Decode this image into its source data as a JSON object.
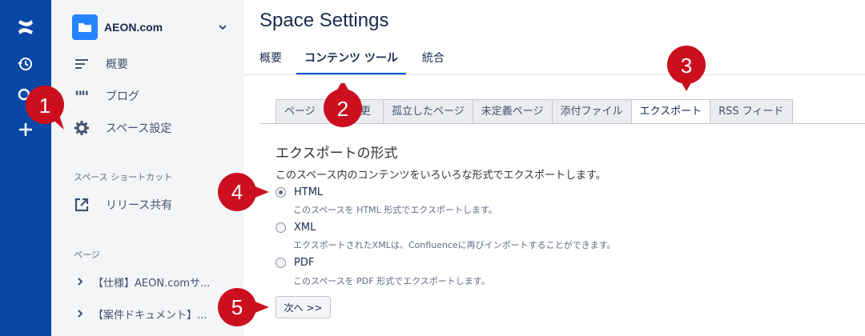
{
  "rail": {
    "icons": [
      "confluence-logo-icon",
      "recent-history-icon",
      "search-icon",
      "create-plus-icon"
    ]
  },
  "sidebar": {
    "space_name": "AEON.com",
    "nav": [
      {
        "label": "概要",
        "icon": "overview-icon"
      },
      {
        "label": "ブログ",
        "icon": "blog-quote-icon"
      },
      {
        "label": "スペース設定",
        "icon": "gear-icon"
      }
    ],
    "shortcuts_title": "スペース ショートカット",
    "shortcuts": [
      {
        "label": "リリース共有",
        "icon": "external-link-icon"
      }
    ],
    "pages_title": "ページ",
    "pages": [
      {
        "label": "【仕様】AEON.comサ..."
      },
      {
        "label": "【案件ドキュメント】..."
      }
    ]
  },
  "main": {
    "title": "Space Settings",
    "top_tabs": [
      {
        "label": "概要"
      },
      {
        "label": "コンテンツ ツール",
        "active": true
      },
      {
        "label": "統合"
      }
    ],
    "sub_tabs": [
      {
        "label": "ページ",
        "visible_prefix": "ページ",
        "visible_suffix": "更"
      },
      {
        "label": "孤立したページ"
      },
      {
        "label": "未定義ページ"
      },
      {
        "label": "添付ファイル"
      },
      {
        "label": "エクスポート",
        "active": true
      },
      {
        "label": "RSS フィード"
      }
    ],
    "export": {
      "heading": "エクスポートの形式",
      "description": "このスペース内のコンテンツをいろいろな形式でエクスポートします。",
      "options": [
        {
          "label": "HTML",
          "desc": "このスペースを HTML 形式でエクスポートします。",
          "checked": true
        },
        {
          "label": "XML",
          "desc": "エクスポートされたXMLは、Confluenceに再びインポートすることができます。",
          "checked": false
        },
        {
          "label": "PDF",
          "desc": "このスペースを PDF 形式でエクスポートします。",
          "checked": false
        }
      ],
      "next_button": "次へ >>"
    }
  },
  "markers": [
    "1",
    "2",
    "3",
    "4",
    "5"
  ],
  "colors": {
    "rail": "#0747a6",
    "sidebar": "#f4f5f7",
    "accent": "#0052cc",
    "marker": "#cc0f1f"
  }
}
